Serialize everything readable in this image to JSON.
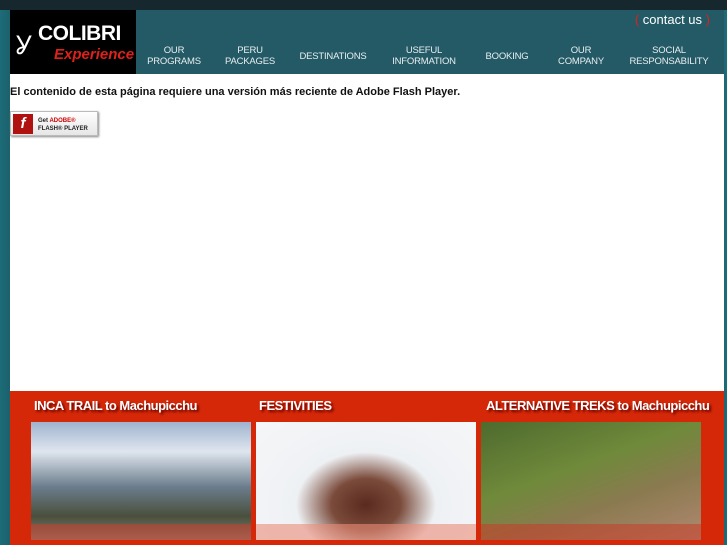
{
  "header": {
    "logo_line1": "COLIBRI",
    "logo_line2": "Experience",
    "contact": "contact us",
    "nav": [
      [
        "OUR",
        "PROGRAMS"
      ],
      [
        "PERU",
        "PACKAGES"
      ],
      [
        "DESTINATIONS"
      ],
      [
        "USEFUL",
        "INFORMATION"
      ],
      [
        "BOOKING"
      ],
      [
        "OUR",
        "COMPANY"
      ],
      [
        "SOCIAL",
        "RESPONSABILITY"
      ]
    ]
  },
  "main": {
    "message": "El contenido de esta página requiere una versión más reciente de Adobe Flash Player.",
    "flash_button": {
      "get": "Get",
      "adobe": "ADOBE®",
      "player": "FLASH® PLAYER"
    }
  },
  "promos": [
    {
      "title": "INCA TRAIL to Machupicchu"
    },
    {
      "title": "FESTIVITIES"
    },
    {
      "title": "ALTERNATIVE TREKS to Machupicchu"
    }
  ]
}
